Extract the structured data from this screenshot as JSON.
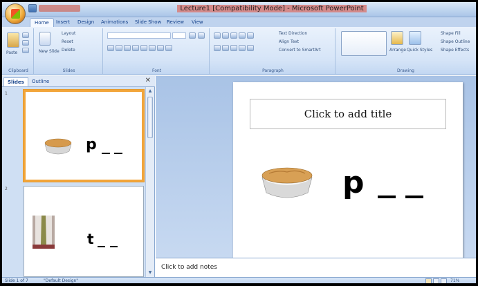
{
  "window": {
    "title": "Lecture1 [Compatibility Mode] - Microsoft PowerPoint"
  },
  "ribbon_tabs": [
    "Home",
    "Insert",
    "Design",
    "Animations",
    "Slide Show",
    "Review",
    "View"
  ],
  "ribbon": {
    "clipboard": {
      "paste_label": "Paste",
      "group_label": "Clipboard"
    },
    "slides": {
      "new_slide_label": "New Slide",
      "layout_label": "Layout",
      "reset_label": "Reset",
      "delete_label": "Delete",
      "group_label": "Slides"
    },
    "font": {
      "group_label": "Font"
    },
    "paragraph": {
      "text_direction_label": "Text Direction",
      "align_text_label": "Align Text",
      "convert_label": "Convert to SmartArt",
      "group_label": "Paragraph"
    },
    "drawing": {
      "arrange_label": "Arrange",
      "quick_styles_label": "Quick Styles",
      "shape_fill_label": "Shape Fill",
      "shape_outline_label": "Shape Outline",
      "shape_effects_label": "Shape Effects",
      "group_label": "Drawing"
    }
  },
  "left_pane": {
    "tabs": [
      "Slides",
      "Outline"
    ],
    "slides": [
      {
        "number": "1",
        "letter": "p",
        "image": "pie-image",
        "selected": true
      },
      {
        "number": "2",
        "letter": "t",
        "image": "shirt-tie-image",
        "selected": false
      }
    ]
  },
  "slide": {
    "title_placeholder": "Click to add title",
    "letter": "p",
    "image": "pie-image"
  },
  "notes": {
    "placeholder": "Click to add notes"
  },
  "status": {
    "slide_info": "Slide 1 of 7",
    "theme": "\"Default Design\"",
    "zoom": "71%"
  }
}
